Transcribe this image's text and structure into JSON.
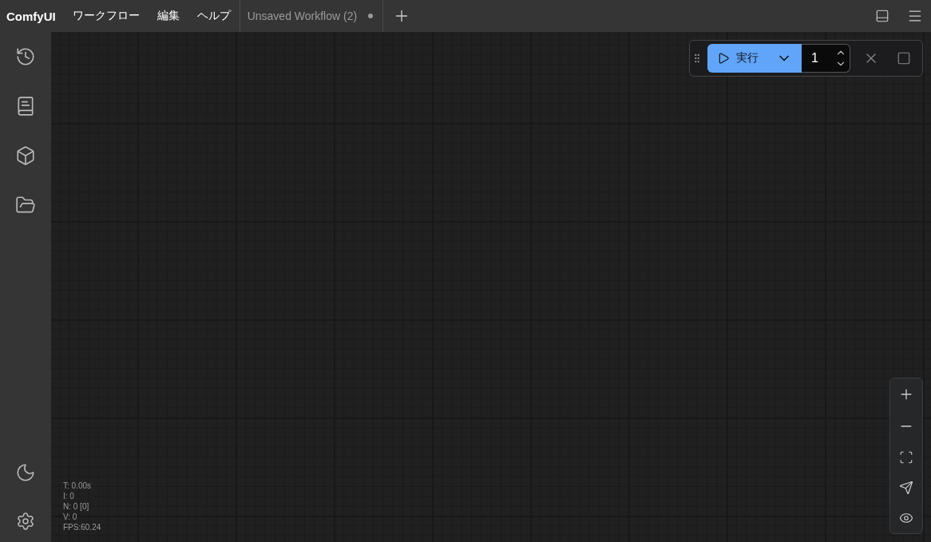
{
  "topbar": {
    "app_name": "ComfyUI",
    "menu": [
      "ワークフロー",
      "編集",
      "ヘルプ"
    ],
    "tabs": [
      {
        "title": "Unsaved Workflow (2)",
        "modified": true,
        "selected": false
      }
    ]
  },
  "run_panel": {
    "label": "実行",
    "batch_count": "1"
  },
  "stats": [
    "T: 0.00s",
    "I: 0",
    "N: 0 [0]",
    "V: 0",
    "FPS:60.24"
  ]
}
